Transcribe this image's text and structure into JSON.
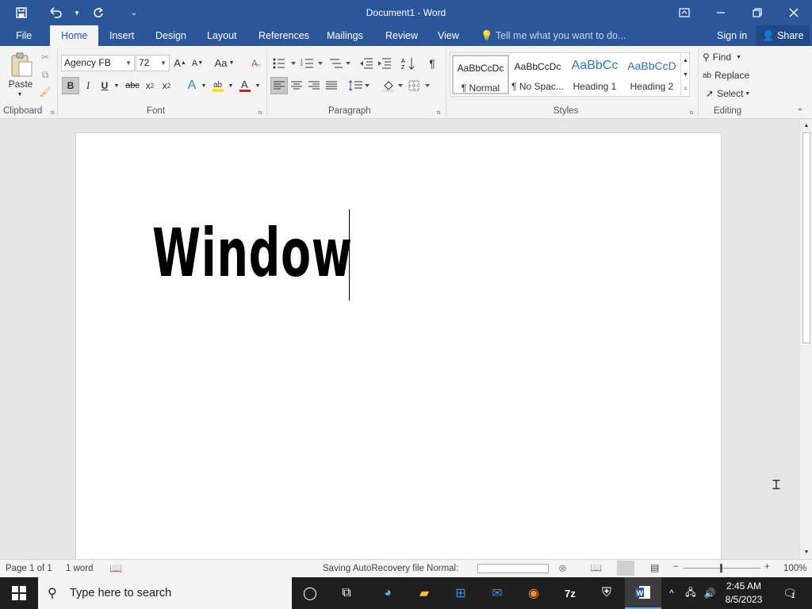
{
  "window": {
    "title": "Document1 - Word",
    "accent": "#2b579a"
  },
  "tabs": {
    "file": "File",
    "home": "Home",
    "insert": "Insert",
    "design": "Design",
    "layout": "Layout",
    "references": "References",
    "mailings": "Mailings",
    "review": "Review",
    "view": "View",
    "tell_me": "Tell me what you want to do...",
    "sign_in": "Sign in",
    "share": "Share"
  },
  "ribbon": {
    "clipboard": {
      "label": "Clipboard",
      "paste": "Paste"
    },
    "font": {
      "label": "Font",
      "family": "Agency FB",
      "size": "72"
    },
    "paragraph": {
      "label": "Paragraph"
    },
    "styles": {
      "label": "Styles",
      "items": [
        {
          "preview": "AaBbCcDc",
          "name": "¶ Normal"
        },
        {
          "preview": "AaBbCcDc",
          "name": "¶ No Spac..."
        },
        {
          "preview": "AaBbCc",
          "name": "Heading 1"
        },
        {
          "preview": "AaBbCcD",
          "name": "Heading 2"
        }
      ]
    },
    "editing": {
      "label": "Editing",
      "find": "Find",
      "replace": "Replace",
      "select": "Select"
    }
  },
  "document": {
    "text": "Window"
  },
  "status": {
    "page": "Page 1 of 1",
    "words": "1 word",
    "saving": "Saving AutoRecovery file Normal:",
    "zoom": "100%"
  },
  "taskbar": {
    "search_placeholder": "Type here to search",
    "time": "2:45 AM",
    "date": "8/5/2023",
    "notifications": "1"
  }
}
